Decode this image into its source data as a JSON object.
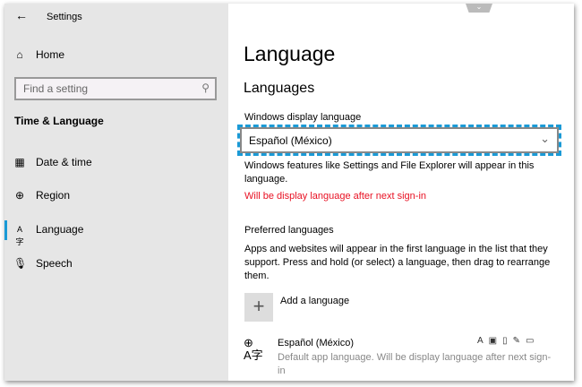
{
  "window": {
    "title": "Settings"
  },
  "sidebar": {
    "home": "Home",
    "search_placeholder": "Find a setting",
    "section": "Time & Language",
    "items": [
      {
        "label": "Date & time",
        "icon": "calendar-clock-icon"
      },
      {
        "label": "Region",
        "icon": "globe-icon"
      },
      {
        "label": "Language",
        "icon": "language-icon"
      },
      {
        "label": "Speech",
        "icon": "microphone-icon"
      }
    ],
    "selected": "Language"
  },
  "main": {
    "title": "Language",
    "section": "Languages",
    "display_label": "Windows display language",
    "display_value": "Español (México)",
    "display_desc": "Windows features like Settings and File Explorer will appear in this language.",
    "warning": "Will be display language after next sign-in",
    "warning_color": "#e81123",
    "preferred_title": "Preferred languages",
    "preferred_desc": "Apps and websites will appear in the first language in the list that they support. Press and hold (or select) a language, then drag to rearrange them.",
    "add_label": "Add a language",
    "languages": [
      {
        "name": "Español (México)",
        "desc": "Default app language. Will be display language after next sign-in"
      }
    ]
  },
  "colors": {
    "accent": "#1a9ad6"
  }
}
